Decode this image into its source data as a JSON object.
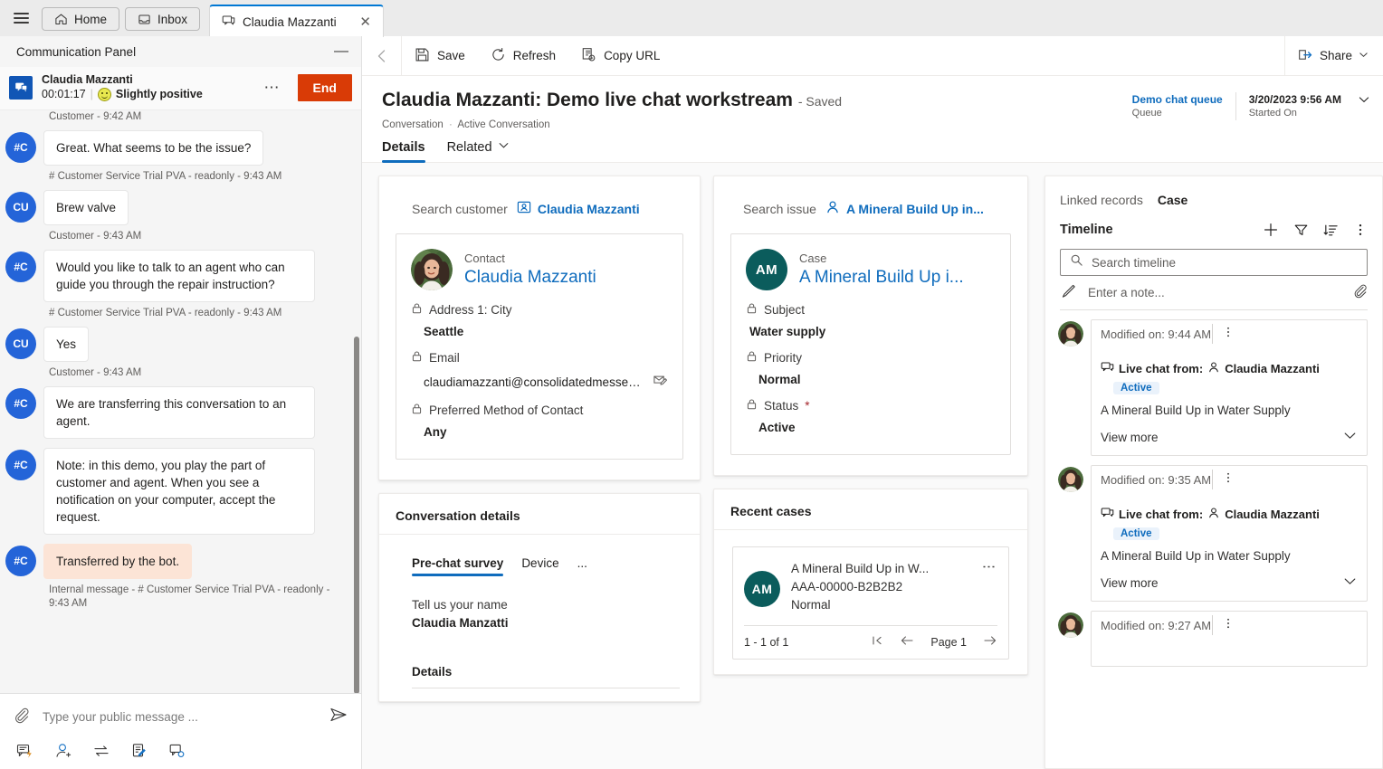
{
  "tabstrip": {
    "menu_icon": "hamburger-icon",
    "tabs": [
      {
        "label": "Home",
        "icon": "home-icon"
      },
      {
        "label": "Inbox",
        "icon": "inbox-icon"
      }
    ],
    "active_tab": {
      "label": "Claudia Mazzanti",
      "icon": "chat-icon",
      "close_icon": "close-icon"
    }
  },
  "communication_panel": {
    "title": "Communication Panel",
    "minimize_icon": "minimize-icon",
    "conversation": {
      "name": "Claudia Mazzanti",
      "timer": "00:01:17",
      "sentiment": "Slightly positive",
      "sentiment_icon": "smiley-icon",
      "more_icon": "more-options-icon",
      "end_label": "End"
    },
    "messages": [
      {
        "type": "meta-only",
        "meta": "Customer - 9:42 AM"
      },
      {
        "type": "bot",
        "avatar": "#C",
        "text": "Great. What seems to be the issue?",
        "meta": "# Customer Service Trial PVA - readonly - 9:43 AM"
      },
      {
        "type": "customer",
        "avatar": "CU",
        "text": "Brew valve",
        "meta": "Customer - 9:43 AM"
      },
      {
        "type": "bot",
        "avatar": "#C",
        "text": "Would you like to talk to an agent who can guide you through the repair instruction?",
        "meta": "# Customer Service Trial PVA - readonly - 9:43 AM"
      },
      {
        "type": "customer",
        "avatar": "CU",
        "text": "Yes",
        "meta": "Customer - 9:43 AM"
      },
      {
        "type": "bot",
        "avatar": "#C",
        "text": "We are transferring this conversation to an agent.",
        "meta": ""
      },
      {
        "type": "bot",
        "avatar": "#C",
        "text": "Note: in this demo, you play the part of customer and agent. When you see a notification on your computer, accept the request.",
        "meta": ""
      },
      {
        "type": "internal",
        "avatar": "#C",
        "text": "Transferred by the bot.",
        "meta": "Internal message - # Customer Service Trial PVA - readonly - 9:43 AM"
      }
    ],
    "composer": {
      "attach_icon": "attachment-icon",
      "placeholder": "Type your public message ...",
      "send_icon": "send-icon"
    },
    "tools": [
      "quick-replies-icon",
      "add-agent-icon",
      "transfer-icon",
      "notes-icon",
      "consult-icon"
    ]
  },
  "command_bar": {
    "back_icon": "back-arrow-icon",
    "save": "Save",
    "refresh": "Refresh",
    "copy_url": "Copy URL",
    "share": "Share",
    "share_icon": "share-icon"
  },
  "record": {
    "title": "Claudia Mazzanti: Demo live chat workstream",
    "saved_suffix": "- Saved",
    "breadcrumb_entity": "Conversation",
    "breadcrumb_view": "Active Conversation",
    "header_fields": [
      {
        "value": "Demo chat queue",
        "label": "Queue",
        "is_link": true
      },
      {
        "value": "3/20/2023 9:56 AM",
        "label": "Started On",
        "is_link": false
      }
    ],
    "tabs": [
      {
        "label": "Details",
        "selected": true,
        "chevron": false
      },
      {
        "label": "Related",
        "selected": false,
        "chevron": true
      }
    ]
  },
  "customer_card": {
    "search_label": "Search customer",
    "search_value": "Claudia Mazzanti",
    "search_icon": "contact-card-icon",
    "entity_type": "Contact",
    "name": "Claudia Mazzanti",
    "avatar": "photo",
    "fields": [
      {
        "label": "Address 1: City",
        "value": "Seattle",
        "lock_icon": "lock-icon",
        "bold": true
      },
      {
        "label": "Email",
        "value": "claudiamazzanti@consolidatedmessenger....",
        "lock_icon": "lock-icon",
        "bold": false,
        "trailing_icon": "email-icon"
      },
      {
        "label": "Preferred Method of Contact",
        "value": "Any",
        "lock_icon": "lock-icon",
        "bold": true
      }
    ]
  },
  "issue_card": {
    "search_label": "Search issue",
    "search_value": "A Mineral Build Up in...",
    "search_icon": "person-icon",
    "entity_type": "Case",
    "name": "A Mineral Build Up i...",
    "initials": "AM",
    "fields": [
      {
        "label": "Subject",
        "value": "Water supply",
        "lock_icon": "lock-icon",
        "required": false
      },
      {
        "label": "Priority",
        "value": "Normal",
        "lock_icon": "lock-icon",
        "required": false
      },
      {
        "label": "Status",
        "value": "Active",
        "lock_icon": "lock-icon",
        "required": true
      }
    ]
  },
  "conversation_details": {
    "title": "Conversation details",
    "tabs": [
      {
        "label": "Pre-chat survey",
        "selected": true
      },
      {
        "label": "Device",
        "selected": false
      },
      {
        "label": "...",
        "selected": false
      }
    ],
    "survey": [
      {
        "question": "Tell us your name",
        "answer": "Claudia Manzatti"
      }
    ],
    "details_heading": "Details"
  },
  "recent_cases": {
    "title": "Recent cases",
    "items": [
      {
        "initials": "AM",
        "title": "A Mineral Build Up in W...",
        "number": "AAA-00000-B2B2B2",
        "priority": "Normal",
        "kebab_icon": "more-options-icon"
      }
    ],
    "footer": {
      "count": "1 - 1 of 1",
      "first_icon": "first-page-icon",
      "prev_icon": "previous-page-icon",
      "page_label": "Page 1",
      "next_icon": "next-page-icon"
    }
  },
  "linked_records": {
    "label": "Linked records",
    "selected": "Case"
  },
  "timeline": {
    "title": "Timeline",
    "actions": [
      {
        "icon": "plus-icon",
        "name": "add-timeline-record"
      },
      {
        "icon": "filter-icon",
        "name": "filter-timeline"
      },
      {
        "icon": "sort-icon",
        "name": "sort-timeline"
      },
      {
        "icon": "more-options-icon",
        "name": "timeline-more-commands"
      }
    ],
    "search_placeholder": "Search timeline",
    "search_icon": "search-icon",
    "note_placeholder": "Enter a note...",
    "note_icon": "pencil-icon",
    "note_attach_icon": "attachment-icon",
    "items": [
      {
        "modified": "Modified on: 9:44 AM",
        "kebab_icon": "more-options-icon",
        "chat_icon": "chat-icon",
        "from_label": "Live chat from:",
        "person_icon": "person-icon",
        "person": "Claudia Mazzanti",
        "status": "Active",
        "description": "A Mineral Build Up in Water Supply",
        "view_more": "View more",
        "chevron_icon": "chevron-down-icon"
      },
      {
        "modified": "Modified on: 9:35 AM",
        "kebab_icon": "more-options-icon",
        "chat_icon": "chat-icon",
        "from_label": "Live chat from:",
        "person_icon": "person-icon",
        "person": "Claudia Mazzanti",
        "status": "Active",
        "description": "A Mineral Build Up in Water Supply",
        "view_more": "View more",
        "chevron_icon": "chevron-down-icon"
      },
      {
        "modified": "Modified on: 9:27 AM",
        "kebab_icon": "more-options-icon",
        "chat_icon": "chat-icon",
        "from_label": "",
        "person_icon": "person-icon",
        "person": "",
        "status": "",
        "description": "",
        "view_more": "",
        "chevron_icon": "chevron-down-icon"
      }
    ]
  },
  "colors": {
    "accent": "#0f6cbd",
    "end_button": "#d93b06",
    "avatar_blue": "#2464d8",
    "case_teal": "#0b5c5c",
    "internal_bubble": "#fce4d6"
  }
}
